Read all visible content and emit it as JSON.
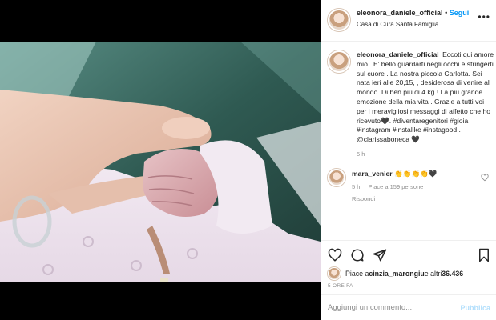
{
  "header": {
    "username": "eleonora_daniele_official",
    "separator": "•",
    "follow_label": "Segui",
    "location": "Casa di Cura Santa Famiglia",
    "more_icon": "more-options-icon"
  },
  "caption": {
    "username": "eleonora_daniele_official",
    "text": "Eccoti qui amore mio . E' bello guardarti negli occhi e stringerti sul cuore . La nostra piccola Carlotta. Sei nata ieri alle 20,15, , desiderosa di venire al mondo. Di ben più di 4 kg ! La più grande emozione della mia vita . Grazie a tutti voi per i meravigliosi messaggi di affetto che ho ricevuto🖤.",
    "hashtags": "#diventaregenitori #gioia #instagram #instalike #instagood .",
    "mention": "@clarissaboneca 🖤",
    "time": "5 h"
  },
  "comment": {
    "username": "mara_venier",
    "text": "👏👏👏👏🖤",
    "time": "5 h",
    "likes": "Piace a 159 persone",
    "reply": "Rispondi",
    "heart_icon": "heart-outline-icon"
  },
  "actions": {
    "like_icon": "heart-icon",
    "comment_icon": "comment-icon",
    "share_icon": "share-icon",
    "save_icon": "bookmark-icon",
    "liked_by_prefix": "Piace a ",
    "liked_by_user": "cinzia_marongiu",
    "liked_by_suffix": " e altri ",
    "liked_by_count": "36.436",
    "post_age": "5 ORE FA"
  },
  "comment_box": {
    "placeholder": "Aggiungi un commento...",
    "publish_label": "Pubblica"
  },
  "colors": {
    "accent": "#0095f6",
    "text": "#262626",
    "muted": "#8e8e8e",
    "publish_disabled": "#b2dffc"
  }
}
